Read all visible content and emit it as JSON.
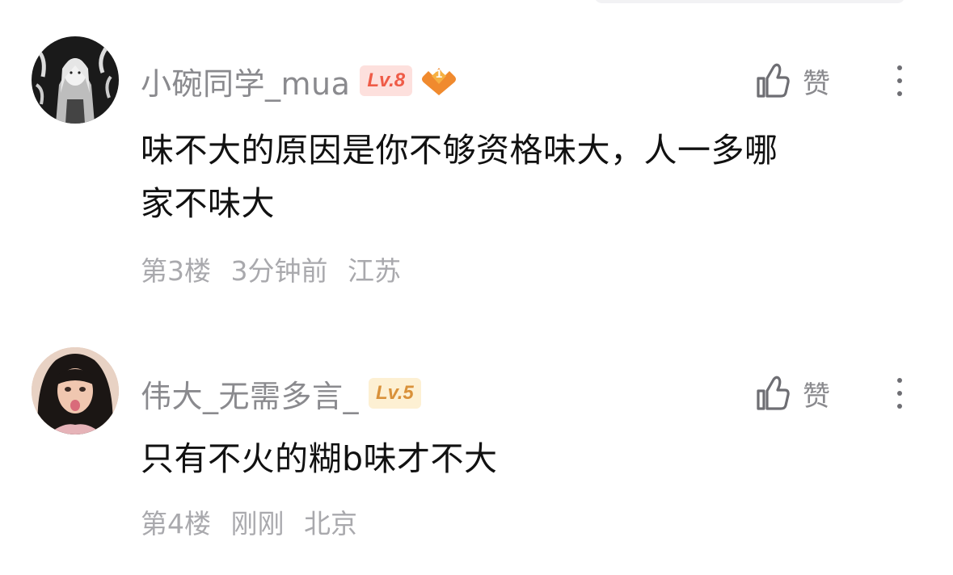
{
  "comments": [
    {
      "avatar_icon": "anime-girl-avatar",
      "username": "小碗同学_mua",
      "level": "Lv.8",
      "fan_badge": "1",
      "like_label": "赞",
      "text_line1": "味不大的原因是你不够资格味大，人一多哪",
      "text_line2": "家不味大",
      "floor": "第3楼",
      "time": "3分钟前",
      "location": "江苏"
    },
    {
      "avatar_icon": "girl-photo-avatar",
      "username": "伟大_无需多言_",
      "level": "Lv.5",
      "like_label": "赞",
      "text_line1": "只有不火的糊b味才不大",
      "floor": "第4楼",
      "time": "刚刚",
      "location": "北京"
    }
  ],
  "colors": {
    "username": "#8a8a8e",
    "comment_text": "#111111",
    "footer_text": "#a9a9ad",
    "lv8_badge_bg": "#fde0dd",
    "lv8_badge_text": "#ef5b47",
    "lv5_badge_bg": "#fdf0d3",
    "lv5_badge_text": "#d9913a",
    "fan_badge": "#f08a2e"
  }
}
